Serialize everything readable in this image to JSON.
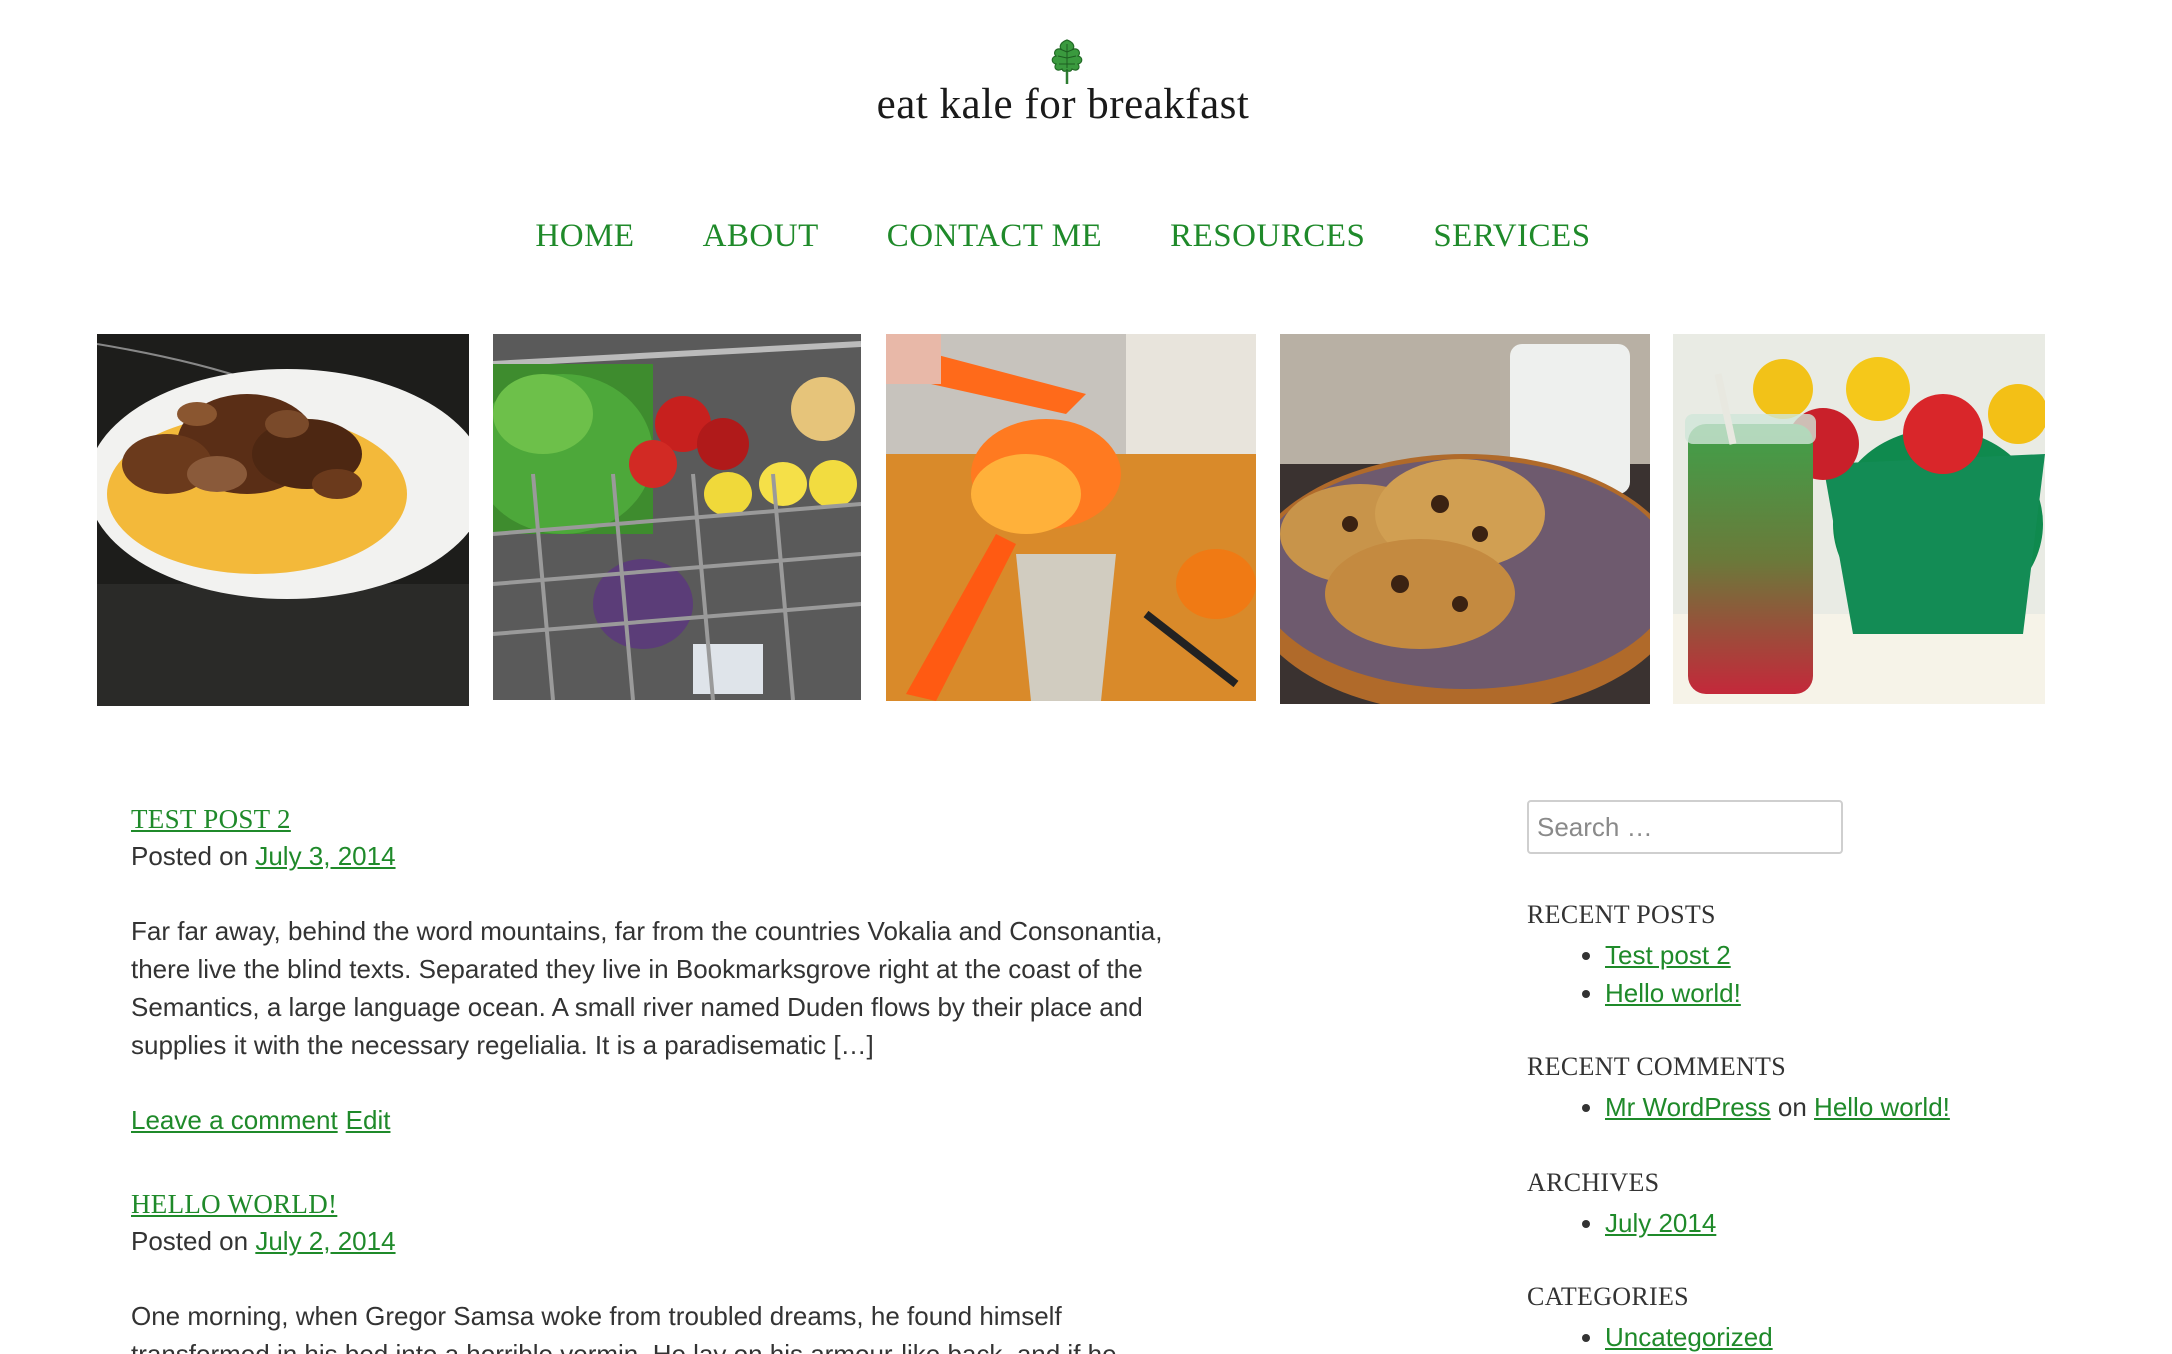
{
  "site": {
    "title": "eat kale for breakfast",
    "logo_icon": "kale-leaf-icon",
    "accent_color": "#1f8a2a"
  },
  "nav": {
    "items": [
      {
        "label": "HOME"
      },
      {
        "label": "ABOUT"
      },
      {
        "label": "CONTACT ME"
      },
      {
        "label": "RESOURCES"
      },
      {
        "label": "SERVICES"
      }
    ]
  },
  "gallery": {
    "photos": [
      {
        "name": "mushroom-polenta-photo"
      },
      {
        "name": "grocery-cart-photo"
      },
      {
        "name": "citrus-juicer-photo"
      },
      {
        "name": "cookies-milk-photo"
      },
      {
        "name": "juice-fruit-bowl-photo"
      }
    ]
  },
  "posts": [
    {
      "title": "TEST POST 2",
      "posted_prefix": "Posted on",
      "date": "July 3, 2014",
      "excerpt": "Far far away, behind the word mountains, far from the countries Vokalia and Consonantia, there live the blind texts. Separated they live in Bookmarksgrove right at the coast of the Semantics, a large language ocean. A small river named Duden flows by their place and supplies it with the necessary regelialia. It is a paradisematic […]",
      "comment_link": "Leave a comment",
      "edit_link": "Edit"
    },
    {
      "title": "HELLO WORLD!",
      "posted_prefix": "Posted on",
      "date": "July 2, 2014",
      "excerpt": "One morning, when Gregor Samsa woke from troubled dreams, he found himself transformed in his bed into a horrible vermin. He lay on his armour-like back, and if he"
    }
  ],
  "sidebar": {
    "search": {
      "placeholder": "Search …",
      "value": ""
    },
    "recent_posts": {
      "heading": "RECENT POSTS",
      "items": [
        {
          "label": "Test post 2"
        },
        {
          "label": "Hello world!"
        }
      ]
    },
    "recent_comments": {
      "heading": "RECENT COMMENTS",
      "items": [
        {
          "author": "Mr WordPress",
          "on": "on",
          "post": "Hello world!"
        }
      ]
    },
    "archives": {
      "heading": "ARCHIVES",
      "items": [
        {
          "label": "July 2014"
        }
      ]
    },
    "categories": {
      "heading": "CATEGORIES",
      "items": [
        {
          "label": "Uncategorized"
        }
      ]
    }
  }
}
